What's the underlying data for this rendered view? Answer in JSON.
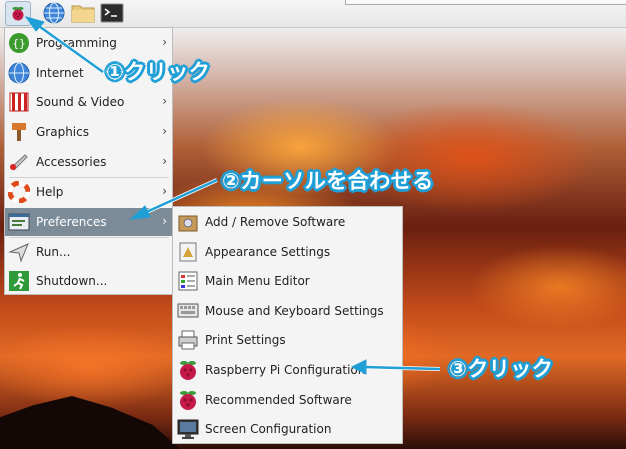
{
  "menu": {
    "items": [
      {
        "label": "Programming",
        "icon": "programming-icon",
        "has_submenu": true
      },
      {
        "label": "Internet",
        "icon": "globe-icon",
        "has_submenu": false
      },
      {
        "label": "Sound & Video",
        "icon": "sound-video-icon",
        "has_submenu": true
      },
      {
        "label": "Graphics",
        "icon": "graphics-brush-icon",
        "has_submenu": true
      },
      {
        "label": "Accessories",
        "icon": "accessories-knife-icon",
        "has_submenu": true
      },
      {
        "label": "Help",
        "icon": "help-lifebuoy-icon",
        "has_submenu": true
      },
      {
        "label": "Preferences",
        "icon": "preferences-icon",
        "has_submenu": true,
        "active": true
      },
      {
        "label": "Run...",
        "icon": "run-icon",
        "has_submenu": false
      },
      {
        "label": "Shutdown...",
        "icon": "shutdown-exit-icon",
        "has_submenu": false
      }
    ],
    "arrow": "›"
  },
  "preferences_submenu": {
    "items": [
      {
        "label": "Add / Remove Software",
        "icon": "package-icon"
      },
      {
        "label": "Appearance Settings",
        "icon": "appearance-icon"
      },
      {
        "label": "Main Menu Editor",
        "icon": "menu-editor-icon"
      },
      {
        "label": "Mouse and Keyboard Settings",
        "icon": "mouse-keyboard-icon"
      },
      {
        "label": "Print Settings",
        "icon": "printer-icon"
      },
      {
        "label": "Raspberry Pi Configuration",
        "icon": "raspberry-icon"
      },
      {
        "label": "Recommended Software",
        "icon": "raspberry-icon"
      },
      {
        "label": "Screen Configuration",
        "icon": "monitor-icon"
      }
    ]
  },
  "annotations": {
    "step1": "①クリック",
    "step2": "②カーソルを合わせる",
    "step3": "③クリック",
    "color": "#1f9fd6"
  },
  "colors": {
    "menu_active": "#7b8b98",
    "menu_bg": "#f4f4f4"
  }
}
